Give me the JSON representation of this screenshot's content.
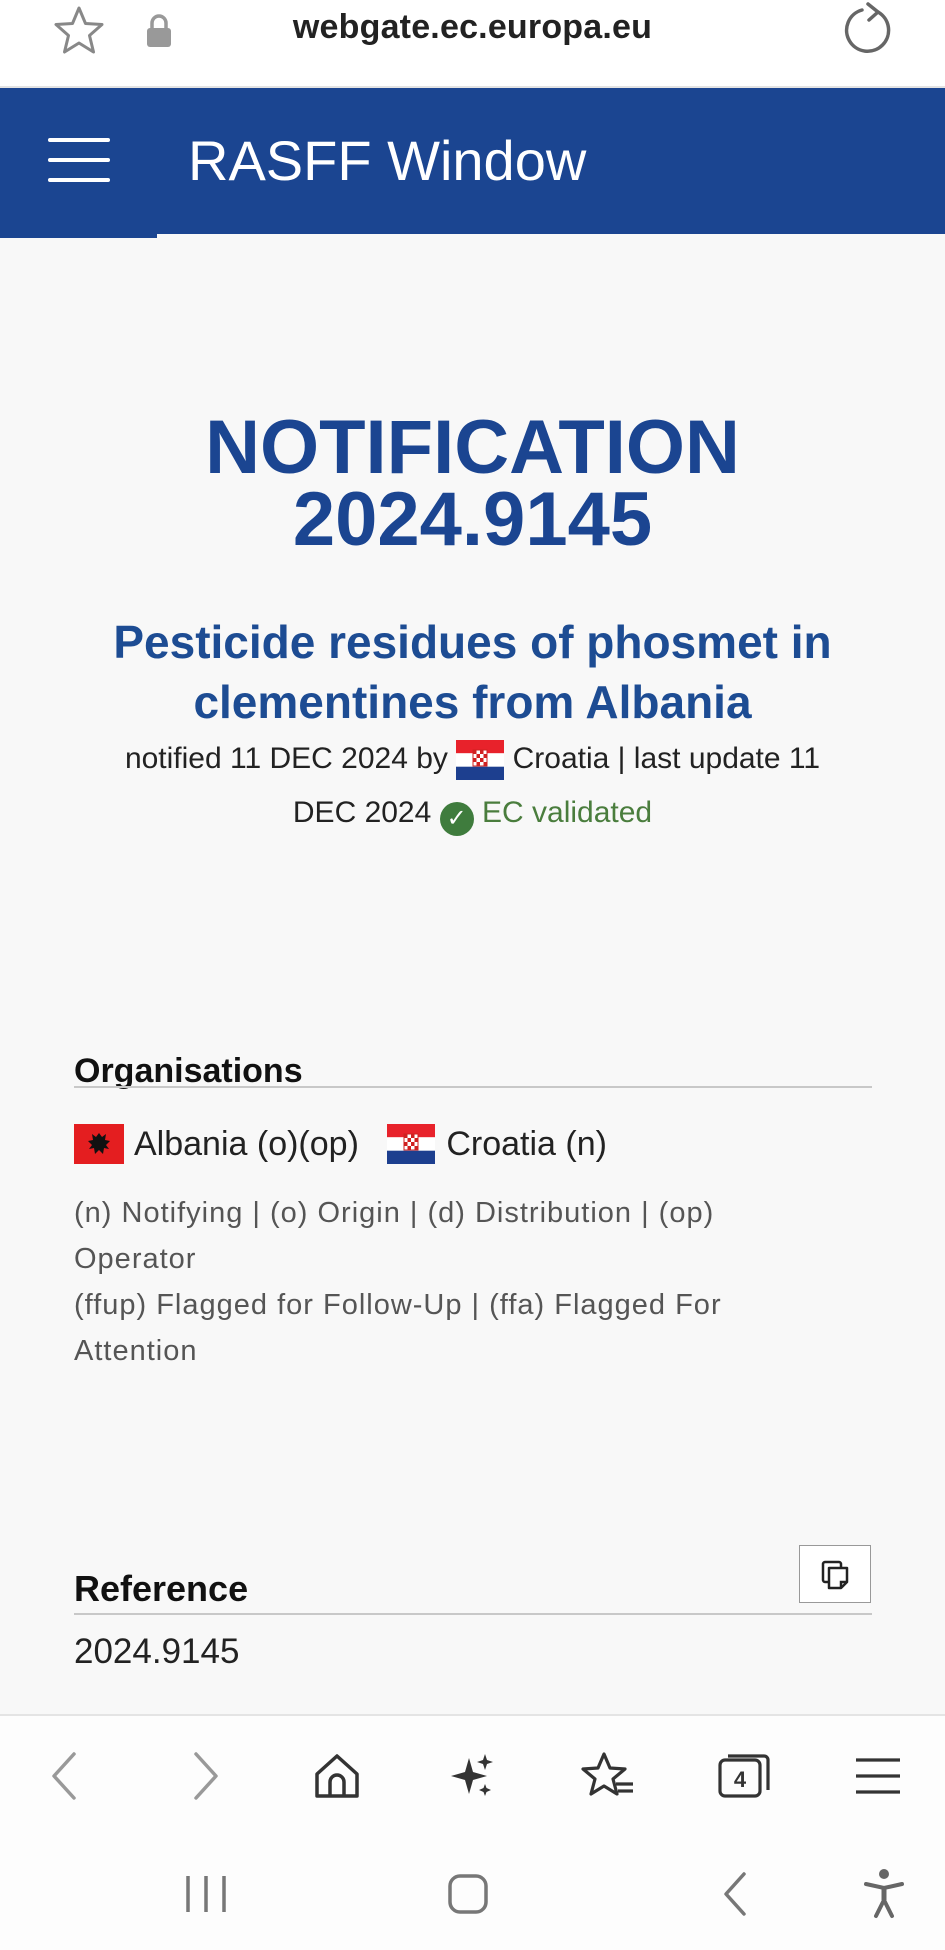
{
  "browser": {
    "url": "webgate.ec.europa.eu",
    "icons": [
      "star-icon",
      "lock-icon",
      "reload-icon"
    ],
    "tab_count": "4",
    "toolbar_icons": [
      "back-icon",
      "forward-icon",
      "home-icon",
      "sparkle-icon",
      "bookmarks-icon",
      "tabs-icon",
      "menu-icon"
    ],
    "navbar_icons": [
      "recents-icon",
      "home-button-icon",
      "back-nav-icon",
      "accessibility-icon"
    ]
  },
  "header": {
    "title": "RASFF Window",
    "bg_color": "#1b4591"
  },
  "notification": {
    "label": "NOTIFICATION",
    "number": "2024.9145",
    "subject": "Pesticide residues of phosmet in clementines from Albania",
    "notified_prefix": "notified 11 DEC 2024 by",
    "notifying_country": "Croatia",
    "update_text": "| last update 11 DEC 2024",
    "status": "EC validated",
    "status_color": "#4a7d3d"
  },
  "organisations": {
    "heading": "Organisations",
    "items": [
      {
        "country": "Albania",
        "roles": "(o)(op)",
        "label": "Albania (o)(op)",
        "flag": "albania-flag"
      },
      {
        "country": "Croatia",
        "roles": "(n)",
        "label": "Croatia (n)",
        "flag": "croatia-flag"
      }
    ],
    "legend_line1": "(n) Notifying | (o) Origin | (d) Distribution | (op) Operator",
    "legend_line2": "(ffup) Flagged for Follow-Up | (ffa) Flagged For Attention"
  },
  "reference": {
    "heading": "Reference",
    "value": "2024.9145",
    "copy_icon": "copy-icon"
  }
}
